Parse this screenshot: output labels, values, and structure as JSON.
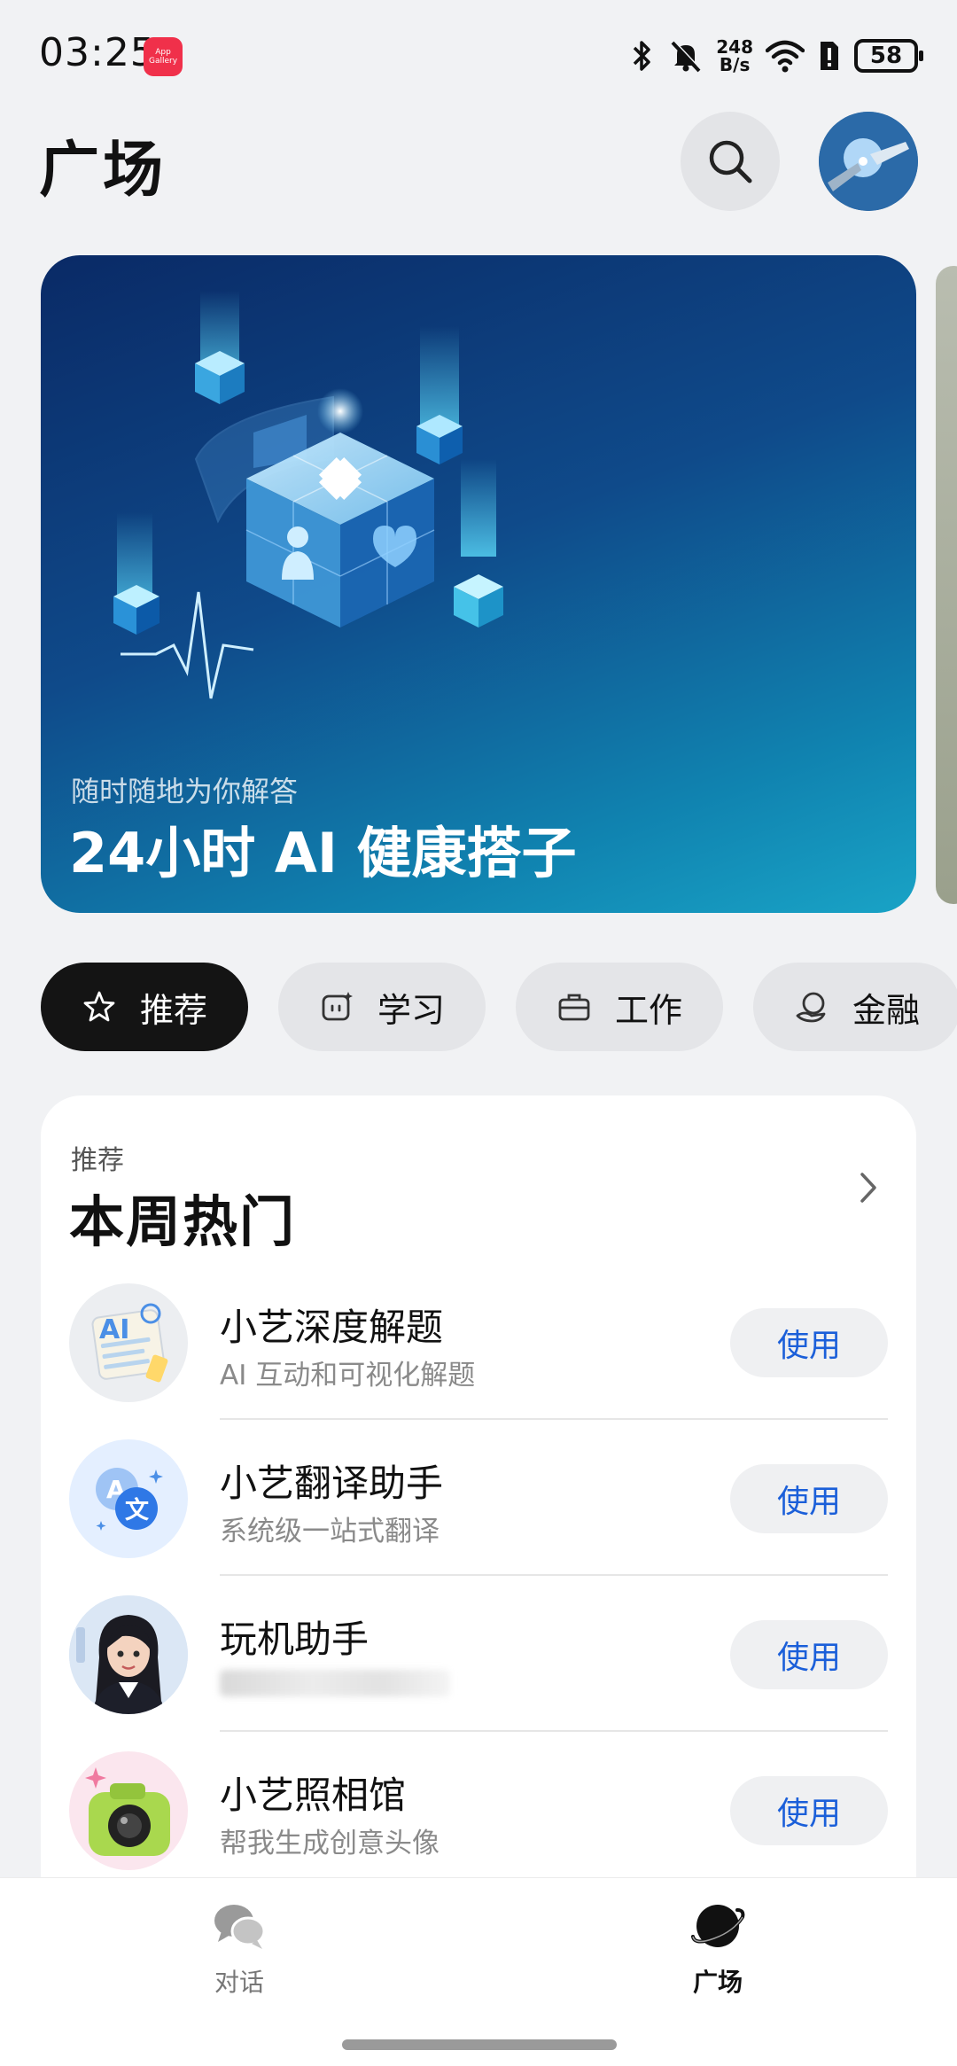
{
  "status_bar": {
    "time": "03:25",
    "app_badge": "App Gallery",
    "net_speed_value": "248",
    "net_speed_unit": "B/s",
    "battery": "58"
  },
  "header": {
    "title": "广场"
  },
  "banner": {
    "subtitle": "随时随地为你解答",
    "title": "24小时 AI 健康搭子"
  },
  "tabs": [
    {
      "label": "推荐",
      "icon": "star-icon",
      "active": true
    },
    {
      "label": "学习",
      "icon": "study-icon",
      "active": false
    },
    {
      "label": "工作",
      "icon": "briefcase-icon",
      "active": false
    },
    {
      "label": "金融",
      "icon": "finance-icon",
      "active": false
    }
  ],
  "card": {
    "eyebrow": "推荐",
    "title": "本周热门",
    "items": [
      {
        "name": "小艺深度解题",
        "desc": "AI 互动和可视化解题",
        "button": "使用",
        "icon": "ai-notebook-icon"
      },
      {
        "name": "小艺翻译助手",
        "desc": "系统级一站式翻译",
        "button": "使用",
        "icon": "translate-icon"
      },
      {
        "name": "玩机助手",
        "desc": "",
        "button": "使用",
        "icon": "assistant-avatar-icon"
      },
      {
        "name": "小艺照相馆",
        "desc": "帮我生成创意头像",
        "button": "使用",
        "icon": "camera-icon"
      }
    ]
  },
  "bottom_nav": {
    "items": [
      {
        "label": "对话",
        "icon": "chat-bubbles-icon"
      },
      {
        "label": "广场",
        "icon": "planet-icon"
      }
    ]
  },
  "colors": {
    "accent": "#1b5fd9",
    "active_tab": "#141414",
    "background": "#f1f2f4"
  }
}
